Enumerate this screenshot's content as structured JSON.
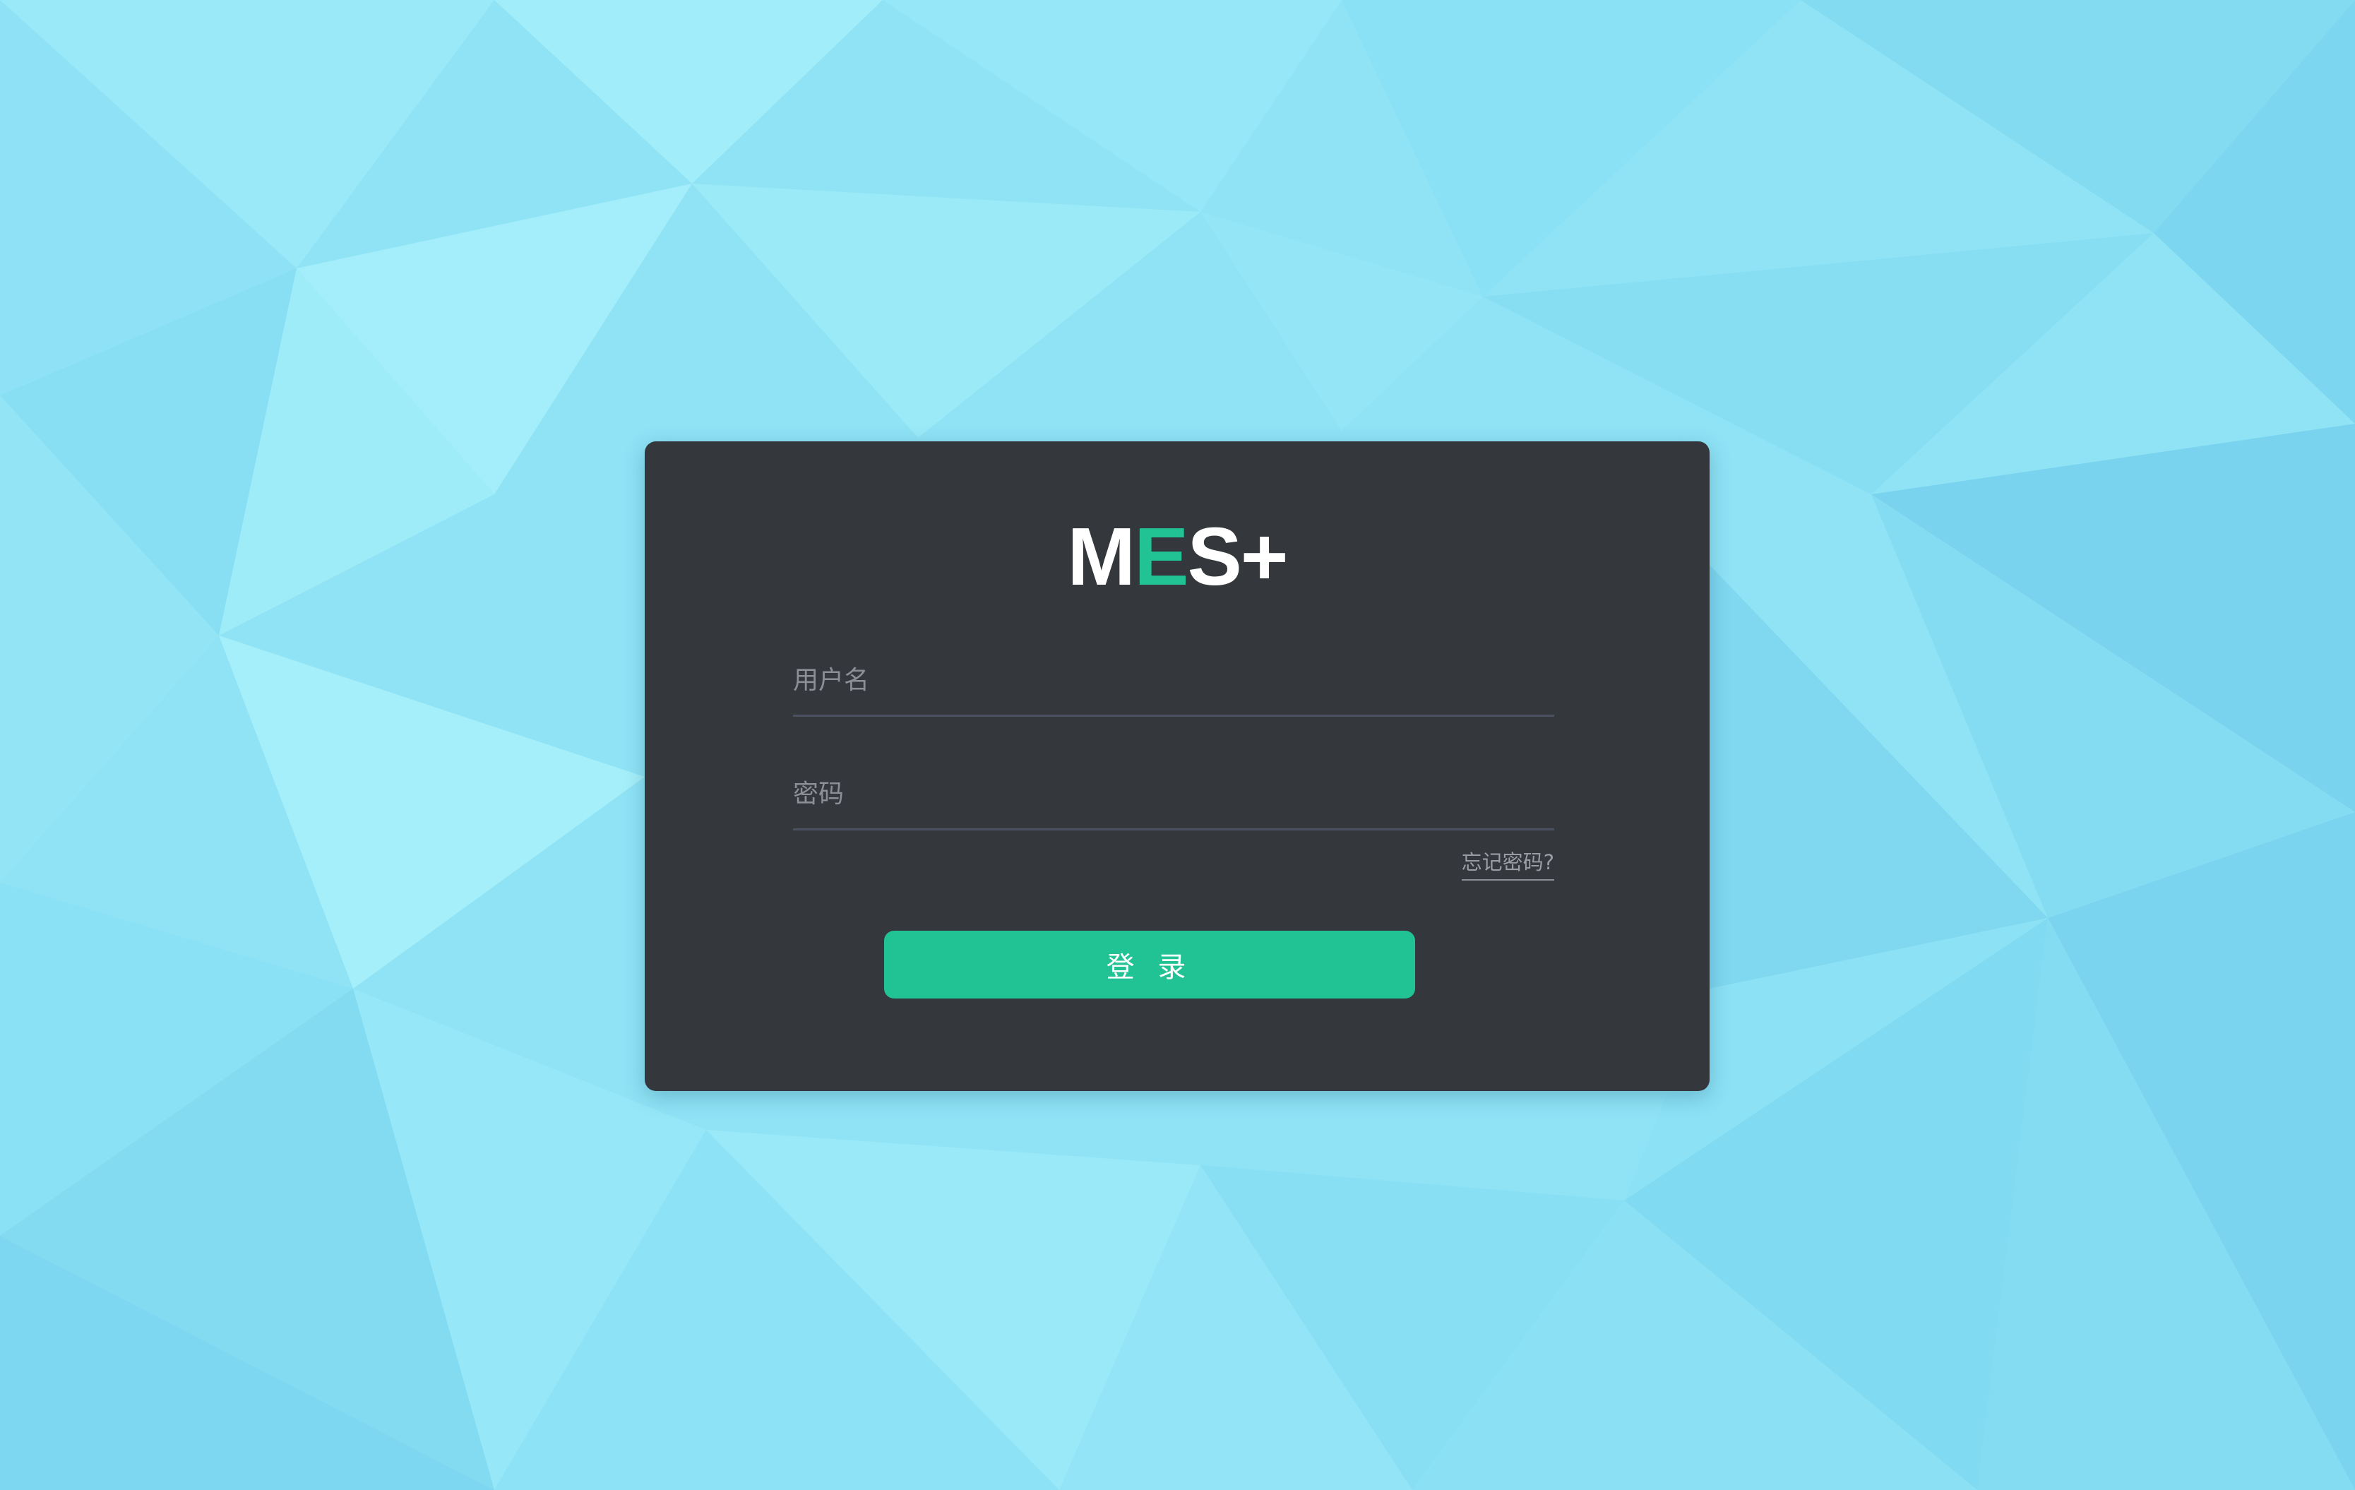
{
  "colors": {
    "background": "#8fe3f5",
    "card": "#34373c",
    "accent": "#21c394",
    "input_underline": "#4b5161"
  },
  "logo": {
    "part1": "M",
    "part2": "E",
    "part3": "S+"
  },
  "login_form": {
    "username_placeholder": "用户名",
    "username_value": "",
    "password_placeholder": "密码",
    "password_value": "",
    "forgot_password": "忘记密码?",
    "login_button": "登 录"
  }
}
